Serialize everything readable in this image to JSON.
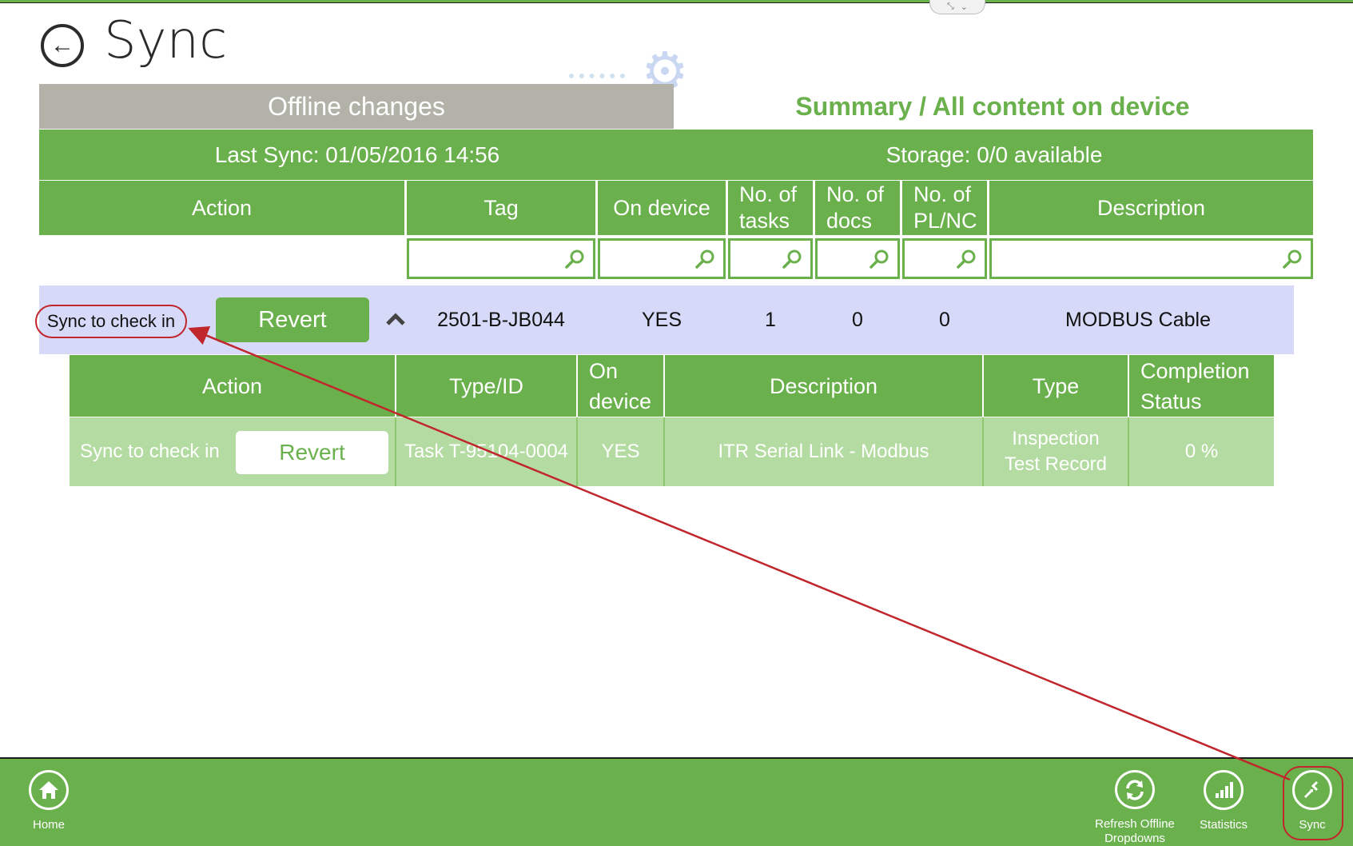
{
  "page": {
    "title": "Sync"
  },
  "tabs": {
    "offline": "Offline changes",
    "summary": "Summary / All content on device"
  },
  "sync_bar": {
    "last_sync": "Last Sync: 01/05/2016 14:56",
    "storage": "Storage: 0/0 available"
  },
  "main_table": {
    "headers": [
      "Action",
      "Tag",
      "On device",
      "No. of tasks",
      "No. of docs",
      "No. of PL/NC",
      "Description"
    ],
    "headers_split": {
      "tasks": [
        "No. of",
        "tasks"
      ],
      "docs": [
        "No. of",
        "docs"
      ],
      "plnc": [
        "No. of",
        "PL/NC"
      ]
    },
    "row": {
      "action": "Sync to check in",
      "revert_label": "Revert",
      "tag": "2501-B-JB044",
      "on_device": "YES",
      "tasks": "1",
      "docs": "0",
      "plnc": "0",
      "description": "MODBUS Cable"
    }
  },
  "sub_table": {
    "headers": [
      "Action",
      "Type/ID",
      "On device",
      "Description",
      "Type",
      "Completion Status"
    ],
    "headers_split": {
      "on_device": [
        "On",
        "device"
      ],
      "completion": [
        "Completion",
        "Status"
      ]
    },
    "row": {
      "action": "Sync to check in",
      "revert_label": "Revert",
      "type_id": "Task T-95104-0004",
      "on_device": "YES",
      "description": "ITR Serial Link - Modbus",
      "type_lines": [
        "Inspection",
        "Test Record"
      ],
      "completion": "0 %"
    }
  },
  "app_bar": {
    "home": "Home",
    "refresh_lines": [
      "Refresh Offline",
      "Dropdowns"
    ],
    "statistics": "Statistics",
    "sync": "Sync"
  },
  "colors": {
    "accent_green": "#6ab04c",
    "light_green": "#b4dca2",
    "row_highlight": "#d6d9f7",
    "tab_gray": "#b2b2a8",
    "annotation_red": "#c0262c"
  },
  "icons": [
    "back-arrow-icon",
    "gear-icon",
    "magnifier-icon",
    "chevron-up-icon",
    "home-icon",
    "refresh-icon",
    "statistics-icon",
    "sync-icon"
  ]
}
